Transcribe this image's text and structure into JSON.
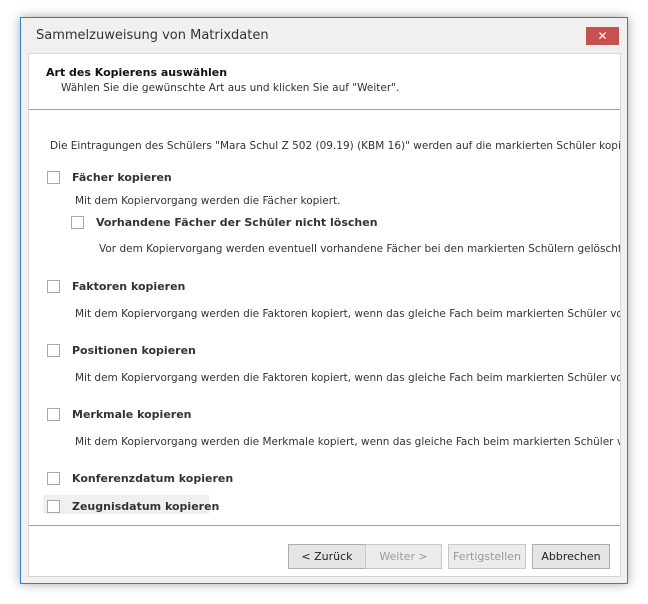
{
  "window": {
    "title": "Sammelzuweisung von Matrixdaten",
    "close": "✕"
  },
  "header": {
    "title": "Art des Kopierens auswählen",
    "subtitle": "Wählen Sie die gewünschte Art aus und klicken Sie auf \"Weiter\"."
  },
  "intro": "Die Eintragungen des Schülers \"Mara Schul Z 502 (09.19) (KBM 16)\" werden auf die markierten Schüler kopiert.",
  "options": [
    {
      "label": "Fächer kopieren",
      "desc": "Mit dem Kopiervorgang  werden die Fächer kopiert.",
      "checked": false
    },
    {
      "label": "Vorhandene Fächer der Schüler nicht löschen",
      "desc": "Vor dem Kopiervorgang werden eventuell vorhandene Fächer bei den markierten Schülern gelöscht. Markieren Sie diese Option, wenn die Fächer erhalten bleiben sollen.",
      "checked": false
    },
    {
      "label": "Faktoren kopieren",
      "desc": "Mit dem Kopiervorgang  werden die Faktoren kopiert, wenn das gleiche Fach beim markierten Schüler vorhanden ist.",
      "checked": false
    },
    {
      "label": "Positionen kopieren",
      "desc": "Mit dem Kopiervorgang  werden die Faktoren kopiert, wenn das gleiche Fach beim markierten Schüler vorhanden ist.",
      "checked": false
    },
    {
      "label": "Merkmale kopieren",
      "desc": "Mit dem Kopiervorgang  werden die Merkmale kopiert, wenn das gleiche Fach beim markierten Schüler vorhanden ist.",
      "checked": false
    },
    {
      "label": "Konferenzdatum kopieren",
      "checked": false
    },
    {
      "label": "Zeugnisdatum kopieren",
      "checked": false
    }
  ],
  "buttons": {
    "back": "< Zurück",
    "next": "Weiter >",
    "finish": "Fertigstellen",
    "cancel": "Abbrechen"
  }
}
